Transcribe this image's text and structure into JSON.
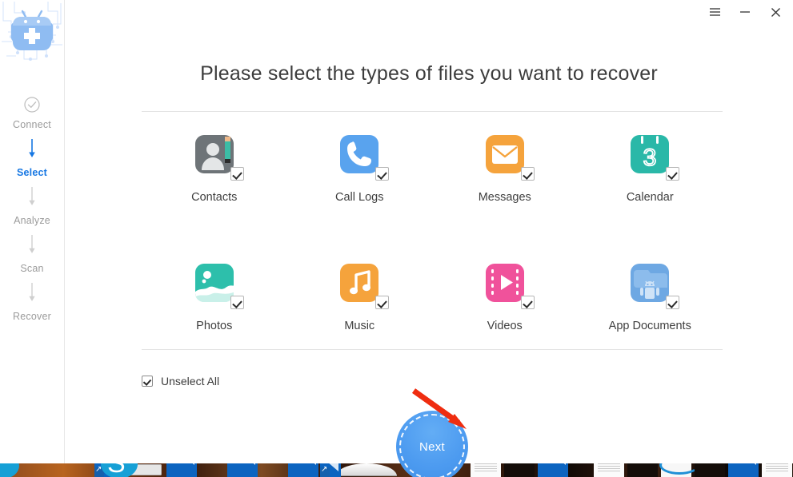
{
  "app": {
    "logo_icon": "android-robot-medical-logo"
  },
  "titlebar": {
    "menu_icon": "hamburger-menu-icon",
    "minimize_icon": "minimize-icon",
    "close_icon": "close-icon"
  },
  "sidebar": {
    "steps": [
      {
        "label": "Connect",
        "icon": "check-circle-icon",
        "state": "done"
      },
      {
        "label": "Select",
        "icon": "",
        "state": "active"
      },
      {
        "label": "Analyze",
        "icon": "",
        "state": "pending"
      },
      {
        "label": "Scan",
        "icon": "",
        "state": "pending"
      },
      {
        "label": "Recover",
        "icon": "",
        "state": "pending"
      }
    ],
    "active_color": "#1677e3",
    "inactive_color": "#9b9b9b"
  },
  "main": {
    "title": "Please select the types of files you want to recover",
    "file_types": [
      {
        "label": "Contacts",
        "icon": "contacts-icon",
        "color": "#6e7478",
        "checked": true
      },
      {
        "label": "Call Logs",
        "icon": "call-logs-icon",
        "color": "#59a3ee",
        "checked": true
      },
      {
        "label": "Messages",
        "icon": "messages-icon",
        "color": "#f5a33c",
        "checked": true
      },
      {
        "label": "Calendar",
        "icon": "calendar-icon",
        "color": "#2ab8a8",
        "checked": true
      },
      {
        "label": "Photos",
        "icon": "photos-icon",
        "color": "#2dbfab",
        "checked": true
      },
      {
        "label": "Music",
        "icon": "music-icon",
        "color": "#f5a33c",
        "checked": true
      },
      {
        "label": "Videos",
        "icon": "videos-icon",
        "color": "#f0529b",
        "checked": true
      },
      {
        "label": "App Documents",
        "icon": "app-documents-icon",
        "color": "#6ea8e3",
        "checked": true
      }
    ],
    "unselect_all": {
      "label": "Unselect All",
      "checked": true
    },
    "next_button": {
      "label": "Next",
      "color": "#4d9bf0"
    },
    "annotation": {
      "arrow_color": "#ef2d10",
      "points_to": "Next"
    }
  }
}
